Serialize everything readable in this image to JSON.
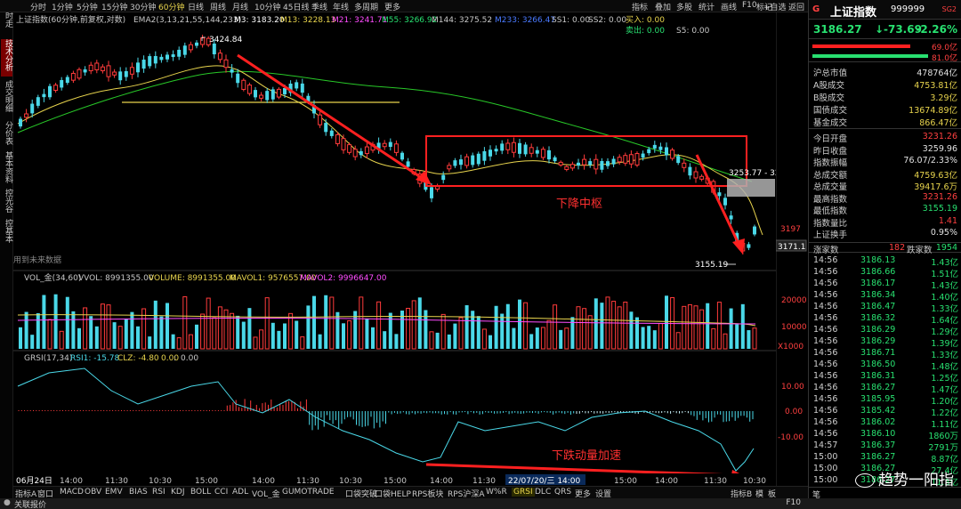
{
  "rail": {
    "tabs": [
      "分时走势",
      "技术分析",
      "成交明细",
      "分价表",
      "基本资料",
      "控光谷",
      "控基本"
    ],
    "active": 1
  },
  "timeframes": [
    "分时",
    "1分钟",
    "5分钟",
    "15分钟",
    "30分钟",
    "60分钟",
    "日线",
    "周线",
    "月线",
    "10分钟",
    "45日线",
    "季线",
    "年线",
    "多周期",
    "更多"
  ],
  "timeframe_active": 5,
  "toolbar_right": [
    "指标",
    "叠加",
    "多股",
    "统计",
    "画线",
    "F10",
    "标记",
    "+自选",
    "返回"
  ],
  "main_legend": {
    "title": "上证指数(60分钟,前复权,对数)",
    "ema": "EMA2(3,13,21,55,144,233)",
    "m3": "M3: 3183.20",
    "m13": "M13: 3228.13",
    "m21": "M21: 3241.71",
    "m55": "M55: 3266.92",
    "m144": "M144: 3275.52",
    "m233": "M233: 3266.47",
    "ss1": "SS1: 0.00",
    "ss2": "SS2: 0.00",
    "buy": "买入: 0.00",
    "sell": "卖出: 0.00",
    "s5": "S5: 0.00"
  },
  "annotations": {
    "high": "3424.84",
    "low": "3155.19",
    "mid_price": "3253.77 - 32",
    "zone_label": "下降中枢",
    "momentum_label": "下跌动量加速",
    "future_hint": "用到未来数据",
    "tooltip": "22/07/20/三 14:00"
  },
  "price_axis": {
    "level1": "3197",
    "badge": "3171.1"
  },
  "vol_legend": {
    "name": "VOL_金(34,60)",
    "vvol": "VVOL: 8991355.00",
    "volume": "VOLUME: 8991355.00",
    "mavol1": "MAVOL1: 9576557.00",
    "mavol2": "MAVOL2: 9996647.00"
  },
  "vol_axis": [
    "20000",
    "10000",
    "X1000"
  ],
  "grsi_legend": {
    "name": "GRSI(17,34)",
    "rsi1": "RSI1: -15.78",
    "clz": "CLZ: -4.80",
    "v3": "0.00",
    "v4": "0.00"
  },
  "grsi_axis": [
    "10.00",
    "0.00",
    "-10.00"
  ],
  "time_axis": [
    "06月24日",
    "14:00",
    "11:30",
    "10:30",
    "15:00",
    "14:00",
    "11:30",
    "10:30",
    "15:00",
    "14:00",
    "11:30",
    "10:30",
    "15:00",
    "14:00",
    "11:30",
    "10:30",
    "60分"
  ],
  "indicator_tabs": [
    "指标A",
    "窗口",
    "MACD",
    "OBV",
    "EMV",
    "BIAS",
    "RSI",
    "KDJ",
    "BOLL",
    "CCI",
    "ADL",
    "VOL_金",
    "GUMOTRADE",
    "口袋突破",
    "口袋HELP",
    "RPS板块",
    "RPS沪深A",
    "W%R",
    "GRSI",
    "DLC",
    "QRS",
    "更多",
    "设置"
  ],
  "indicator_active": "GRSI",
  "bottom_right": [
    "指标B",
    "模",
    "板"
  ],
  "quote": {
    "code_icon": "G",
    "name": "上证指数",
    "code": "999999",
    "tag": "SG2",
    "price": "3186.27",
    "change": "-73.69",
    "change_pct": "-2.26%",
    "bar1": "69.0亿",
    "bar2": "81.0亿",
    "rows": [
      {
        "k": "沪总市值",
        "v": "478764亿",
        "c": "white"
      },
      {
        "k": "A股成交",
        "v": "4753.81亿",
        "c": "yellow"
      },
      {
        "k": "B股成交",
        "v": "3.29亿",
        "c": "yellow"
      },
      {
        "k": "国债成交",
        "v": "13674.89亿",
        "c": "yellow"
      },
      {
        "k": "基金成交",
        "v": "866.47亿",
        "c": "yellow"
      },
      {
        "k": "今日开盘",
        "v": "3231.26",
        "c": "red"
      },
      {
        "k": "昨日收盘",
        "v": "3259.96",
        "c": "white"
      },
      {
        "k": "指数振幅",
        "v": "76.07/2.33%",
        "c": "white"
      },
      {
        "k": "总成交额",
        "v": "4759.63亿",
        "c": "yellow"
      },
      {
        "k": "总成交量",
        "v": "39417.6万",
        "c": "yellow"
      },
      {
        "k": "最高指数",
        "v": "3231.26",
        "c": "red"
      },
      {
        "k": "最低指数",
        "v": "3155.19",
        "c": "green"
      },
      {
        "k": "指数量比",
        "v": "1.41",
        "c": "red"
      },
      {
        "k": "上证换手",
        "v": "0.95%",
        "c": "white"
      }
    ],
    "rise_label": "涨家数",
    "rise": "182",
    "fall_label": "跌家数",
    "fall": "1954",
    "ticks": [
      {
        "t": "14:56",
        "p": "3186.13",
        "q": "1.43亿"
      },
      {
        "t": "14:56",
        "p": "3186.66",
        "q": "1.51亿"
      },
      {
        "t": "14:56",
        "p": "3186.17",
        "q": "1.43亿"
      },
      {
        "t": "14:56",
        "p": "3186.34",
        "q": "1.40亿"
      },
      {
        "t": "14:56",
        "p": "3186.47",
        "q": "1.33亿"
      },
      {
        "t": "14:56",
        "p": "3186.32",
        "q": "1.64亿"
      },
      {
        "t": "14:56",
        "p": "3186.29",
        "q": "1.29亿"
      },
      {
        "t": "14:56",
        "p": "3186.29",
        "q": "1.39亿"
      },
      {
        "t": "14:56",
        "p": "3186.71",
        "q": "1.33亿"
      },
      {
        "t": "14:56",
        "p": "3186.50",
        "q": "1.48亿"
      },
      {
        "t": "14:56",
        "p": "3186.31",
        "q": "1.25亿"
      },
      {
        "t": "14:56",
        "p": "3186.27",
        "q": "1.47亿"
      },
      {
        "t": "14:56",
        "p": "3185.95",
        "q": "1.20亿"
      },
      {
        "t": "14:56",
        "p": "3185.42",
        "q": "1.22亿"
      },
      {
        "t": "14:56",
        "p": "3186.02",
        "q": "1.11亿"
      },
      {
        "t": "14:56",
        "p": "3186.10",
        "q": "1860万"
      },
      {
        "t": "14:57",
        "p": "3186.37",
        "q": "2791万"
      },
      {
        "t": "15:00",
        "p": "3186.27",
        "q": "8.87亿"
      },
      {
        "t": "15:00",
        "p": "3186.27",
        "q": "27.4亿"
      },
      {
        "t": "15:00",
        "p": "3186.27",
        "q": "11.3亿"
      }
    ]
  },
  "watermark": "趋势一阳指",
  "status": "关联报价",
  "status_right": "F10",
  "panel_bottom": "笔"
}
